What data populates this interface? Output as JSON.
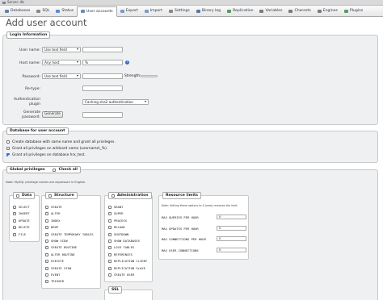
{
  "breadcrumb": {
    "text": "Server: db"
  },
  "tabs": [
    {
      "label": "Databases",
      "color": "#6a7fa8",
      "icon": "database-icon"
    },
    {
      "label": "SQL",
      "color": "#8a8a8a",
      "icon": "sql-icon"
    },
    {
      "label": "Status",
      "color": "#5b8bd1",
      "icon": "status-icon"
    },
    {
      "label": "User accounts",
      "color": "#6d8bb8",
      "icon": "users-icon",
      "active": true
    },
    {
      "label": "Export",
      "color": "#7a9bc9",
      "icon": "export-icon"
    },
    {
      "label": "Import",
      "color": "#7a9bc9",
      "icon": "import-icon"
    },
    {
      "label": "Settings",
      "color": "#888888",
      "icon": "gear-icon"
    },
    {
      "label": "Binary log",
      "color": "#5577aa",
      "icon": "binary-log-icon"
    },
    {
      "label": "Replication",
      "color": "#5d9966",
      "icon": "replication-icon"
    },
    {
      "label": "Variables",
      "color": "#7b7b7b",
      "icon": "variables-icon"
    },
    {
      "label": "Charsets",
      "color": "#7b7b7b",
      "icon": "charsets-icon"
    },
    {
      "label": "Engines",
      "color": "#7b7b7b",
      "icon": "engines-icon"
    },
    {
      "label": "Plugins",
      "color": "#5d9966",
      "icon": "plugins-icon"
    }
  ],
  "page_title": "Add user account",
  "login": {
    "legend": "Login Information",
    "user_name": {
      "label": "User name:",
      "select": "Use text field",
      "value": ""
    },
    "host_name": {
      "label": "Host name:",
      "select": "Any host",
      "value": "%"
    },
    "password": {
      "label": "Password:",
      "select": "Use text field",
      "value": "",
      "strength_label": "Strength:"
    },
    "retype": {
      "label": "Re-type:",
      "value": ""
    },
    "auth_plugin": {
      "label_line1": "Authentication",
      "label_line2": "plugin",
      "select": "Caching sha2 authentication"
    },
    "generate": {
      "label_line1": "Generate",
      "label_line2": "password:",
      "button": "Generate",
      "value": ""
    }
  },
  "database": {
    "legend": "Database for user account",
    "options": [
      {
        "label": "Create database with same name and grant all privileges.",
        "checked": false
      },
      {
        "label": "Grant all privileges on wildcard name (username\\_%).",
        "checked": false
      },
      {
        "label": "Grant all privileges on database hrx_test.",
        "checked": true
      }
    ]
  },
  "global": {
    "legend": "Global privileges",
    "check_all": "Check all",
    "note": "Note: MySQL privilege names are expressed in English.",
    "data": {
      "legend": "Data",
      "items": [
        "SELECT",
        "INSERT",
        "UPDATE",
        "DELETE",
        "FILE"
      ]
    },
    "structure": {
      "legend": "Structure",
      "items": [
        "CREATE",
        "ALTER",
        "INDEX",
        "DROP",
        "CREATE TEMPORARY TABLES",
        "SHOW VIEW",
        "CREATE ROUTINE",
        "ALTER ROUTINE",
        "EXECUTE",
        "CREATE VIEW",
        "EVENT",
        "TRIGGER"
      ]
    },
    "administration": {
      "legend": "Administration",
      "items": [
        "GRANT",
        "SUPER",
        "PROCESS",
        "RELOAD",
        "SHUTDOWN",
        "SHOW DATABASES",
        "LOCK TABLES",
        "REFERENCES",
        "REPLICATION CLIENT",
        "REPLICATION SLAVE",
        "CREATE USER"
      ]
    },
    "limits": {
      "legend": "Resource limits",
      "note": "Note: Setting these options to 0 (zero) removes the limit.",
      "rows": [
        {
          "label": "MAX QUERIES PER HOUR",
          "value": "0"
        },
        {
          "label": "MAX UPDATES PER HOUR",
          "value": "0"
        },
        {
          "label": "MAX CONNECTIONS PER HOUR",
          "value": "0"
        },
        {
          "label": "MAX USER_CONNECTIONS",
          "value": "0"
        }
      ]
    },
    "ssl": {
      "legend": "SSL"
    }
  }
}
